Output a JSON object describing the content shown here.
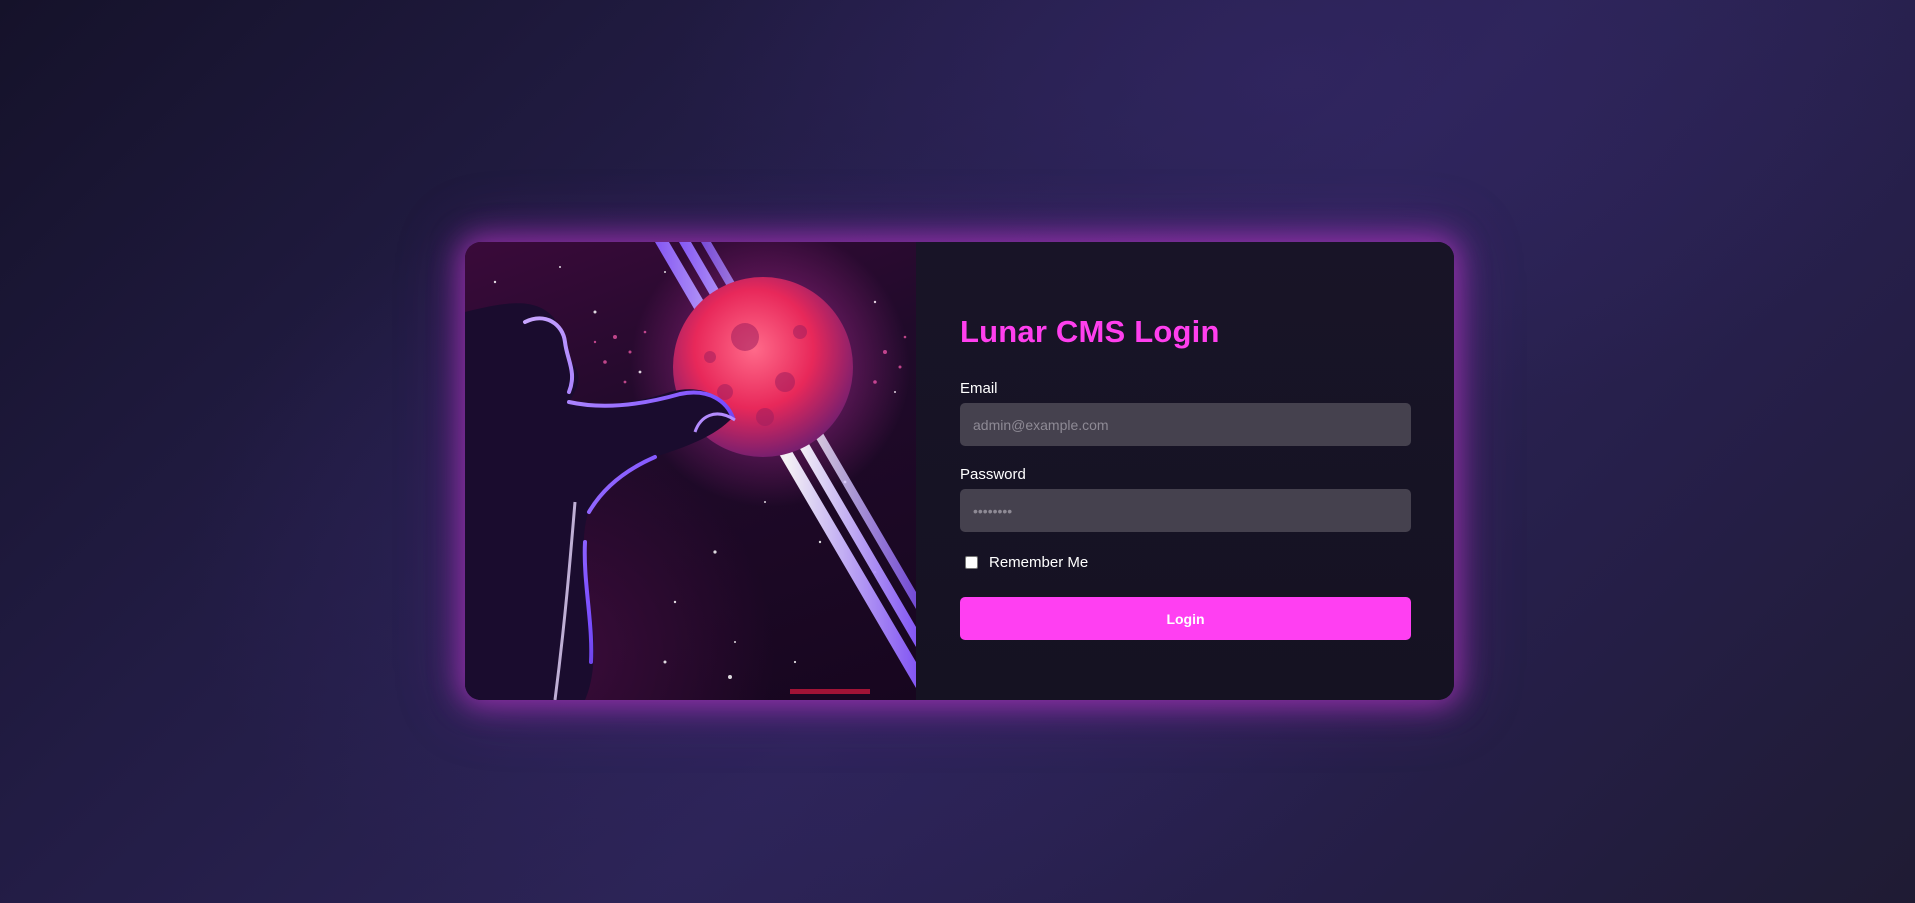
{
  "login": {
    "title": "Lunar CMS Login",
    "email_label": "Email",
    "email_placeholder": "admin@example.com",
    "email_value": "",
    "password_label": "Password",
    "password_placeholder": "••••••••",
    "password_value": "",
    "remember_label": "Remember Me",
    "remember_checked": false,
    "submit_label": "Login"
  },
  "theme": {
    "accent": "#ff3ff2",
    "title_color": "#ff3fee",
    "card_bg": "#171326",
    "input_bg": "#45414e"
  },
  "illustration": {
    "subject": "figure-holding-red-planet-neon-art"
  }
}
